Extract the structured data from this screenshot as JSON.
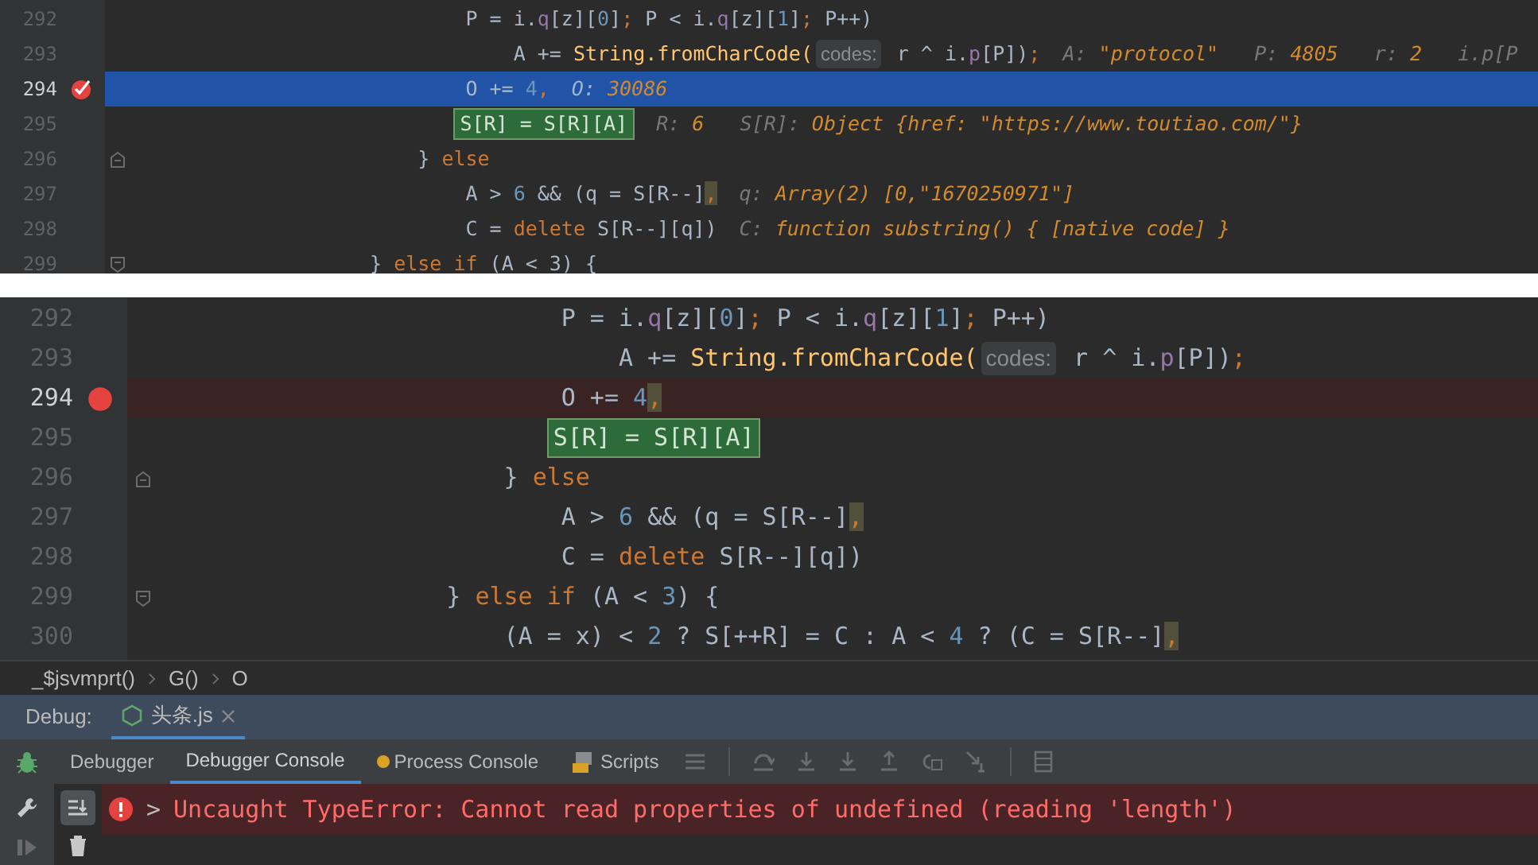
{
  "panels": [
    {
      "lines": [
        {
          "number": "292",
          "current": false,
          "breakpoint": false,
          "fold_start": false,
          "fold_end": false,
          "tokens": [
            {
              "kind": "plain",
              "text": "                            P = i."
            },
            {
              "kind": "field",
              "text": "q"
            },
            {
              "kind": "plain",
              "text": "[z]["
            },
            {
              "kind": "num",
              "text": "0"
            },
            {
              "kind": "plain",
              "text": "]"
            },
            {
              "kind": "kw",
              "text": ";"
            },
            {
              "kind": "plain",
              "text": " P < i."
            },
            {
              "kind": "field",
              "text": "q"
            },
            {
              "kind": "plain",
              "text": "[z]["
            },
            {
              "kind": "num",
              "text": "1"
            },
            {
              "kind": "plain",
              "text": "]"
            },
            {
              "kind": "kw",
              "text": ";"
            },
            {
              "kind": "plain",
              "text": " P++)"
            }
          ]
        },
        {
          "number": "293",
          "current": false,
          "breakpoint": false,
          "fold_start": false,
          "fold_end": false,
          "tokens": [
            {
              "kind": "plain",
              "text": "                                A += "
            },
            {
              "kind": "fn",
              "text": "String.fromCharCode("
            },
            {
              "kind": "hint",
              "text": "codes:"
            },
            {
              "kind": "plain",
              "text": " r ^ i."
            },
            {
              "kind": "field",
              "text": "p"
            },
            {
              "kind": "plain",
              "text": "[P])"
            },
            {
              "kind": "kw",
              "text": ";"
            }
          ],
          "values": [
            {
              "name": "A:",
              "value": "\"protocol\""
            },
            {
              "name": "P:",
              "value": "4805"
            },
            {
              "name": "r:",
              "value": "2"
            },
            {
              "name": "i.p[P"
            }
          ]
        },
        {
          "number": "294",
          "current": true,
          "breakpoint": true,
          "fold_start": false,
          "fold_end": false,
          "tokens": [
            {
              "kind": "plain",
              "text": "                            O += "
            },
            {
              "kind": "num",
              "text": "4"
            },
            {
              "kind": "kw",
              "text": ","
            }
          ],
          "values": [
            {
              "name": "O:",
              "value": "30086"
            }
          ]
        },
        {
          "number": "295",
          "current": false,
          "breakpoint": false,
          "fold_start": false,
          "fold_end": false,
          "tokens": [
            {
              "kind": "boxed",
              "text": "                           S[R] = S[R][A]"
            }
          ],
          "values": [
            {
              "name": "R:",
              "value": "6"
            },
            {
              "name": "S[R]:",
              "value": "Object {href: \"https://www.toutiao.com/\"}"
            }
          ]
        },
        {
          "number": "296",
          "current": false,
          "breakpoint": false,
          "fold_start": false,
          "fold_end": true,
          "tokens": [
            {
              "kind": "plain",
              "text": "                        } "
            },
            {
              "kind": "kw",
              "text": "else"
            }
          ]
        },
        {
          "number": "297",
          "current": false,
          "breakpoint": false,
          "fold_start": false,
          "fold_end": false,
          "tokens": [
            {
              "kind": "plain",
              "text": "                            A > "
            },
            {
              "kind": "num",
              "text": "6"
            },
            {
              "kind": "plain",
              "text": " && (q = S[R--]"
            },
            {
              "kind": "mark",
              "text": ","
            }
          ],
          "values": [
            {
              "name": "q:",
              "value": "Array(2) [0,\"1670250971\"]"
            }
          ]
        },
        {
          "number": "298",
          "current": false,
          "breakpoint": false,
          "fold_start": false,
          "fold_end": false,
          "tokens": [
            {
              "kind": "plain",
              "text": "                            C = "
            },
            {
              "kind": "kw",
              "text": "delete"
            },
            {
              "kind": "plain",
              "text": " S[R--][q])"
            }
          ],
          "values": [
            {
              "name": "C:",
              "value": "function substring() { [native code] }"
            }
          ]
        },
        {
          "number": "299",
          "current": false,
          "breakpoint": false,
          "fold_start": true,
          "fold_end": false,
          "tokens": [
            {
              "kind": "plain",
              "text": "                    } "
            },
            {
              "kind": "kw",
              "text": "else if"
            },
            {
              "kind": "plain",
              "text": " (A < 3) {"
            }
          ]
        }
      ]
    },
    {
      "lines": [
        {
          "number": "292",
          "current": false,
          "breakpoint": false,
          "fold_start": false,
          "fold_end": false,
          "tokens": [
            {
              "kind": "plain",
              "text": "                            P = i."
            },
            {
              "kind": "field",
              "text": "q"
            },
            {
              "kind": "plain",
              "text": "[z]["
            },
            {
              "kind": "num",
              "text": "0"
            },
            {
              "kind": "plain",
              "text": "]"
            },
            {
              "kind": "kw",
              "text": ";"
            },
            {
              "kind": "plain",
              "text": " P < i."
            },
            {
              "kind": "field",
              "text": "q"
            },
            {
              "kind": "plain",
              "text": "[z]["
            },
            {
              "kind": "num",
              "text": "1"
            },
            {
              "kind": "plain",
              "text": "]"
            },
            {
              "kind": "kw",
              "text": ";"
            },
            {
              "kind": "plain",
              "text": " P++)"
            }
          ]
        },
        {
          "number": "293",
          "current": false,
          "breakpoint": false,
          "fold_start": false,
          "fold_end": false,
          "tokens": [
            {
              "kind": "plain",
              "text": "                                A += "
            },
            {
              "kind": "fn",
              "text": "String.fromCharCode("
            },
            {
              "kind": "hint",
              "text": "codes:"
            },
            {
              "kind": "plain",
              "text": " r ^ i."
            },
            {
              "kind": "field",
              "text": "p"
            },
            {
              "kind": "plain",
              "text": "[P])"
            },
            {
              "kind": "kw",
              "text": ";"
            }
          ]
        },
        {
          "number": "294",
          "current": false,
          "breakpoint": true,
          "fold_start": false,
          "fold_end": false,
          "tokens": [
            {
              "kind": "plain",
              "text": "                            O += "
            },
            {
              "kind": "num",
              "text": "4"
            },
            {
              "kind": "mark",
              "text": ","
            }
          ]
        },
        {
          "number": "295",
          "current": false,
          "breakpoint": false,
          "fold_start": false,
          "fold_end": false,
          "tokens": [
            {
              "kind": "boxed",
              "text": "                           S[R] = S[R][A]"
            }
          ]
        },
        {
          "number": "296",
          "current": false,
          "breakpoint": false,
          "fold_start": false,
          "fold_end": true,
          "tokens": [
            {
              "kind": "plain",
              "text": "                        } "
            },
            {
              "kind": "kw",
              "text": "else"
            }
          ]
        },
        {
          "number": "297",
          "current": false,
          "breakpoint": false,
          "fold_start": false,
          "fold_end": false,
          "tokens": [
            {
              "kind": "plain",
              "text": "                            A > "
            },
            {
              "kind": "num",
              "text": "6"
            },
            {
              "kind": "plain",
              "text": " && (q = S[R--]"
            },
            {
              "kind": "mark",
              "text": ","
            }
          ]
        },
        {
          "number": "298",
          "current": false,
          "breakpoint": false,
          "fold_start": false,
          "fold_end": false,
          "tokens": [
            {
              "kind": "plain",
              "text": "                            C = "
            },
            {
              "kind": "kw",
              "text": "delete"
            },
            {
              "kind": "plain",
              "text": " S[R--][q])"
            }
          ]
        },
        {
          "number": "299",
          "current": false,
          "breakpoint": false,
          "fold_start": true,
          "fold_end": false,
          "tokens": [
            {
              "kind": "plain",
              "text": "                    } "
            },
            {
              "kind": "kw",
              "text": "else if"
            },
            {
              "kind": "plain",
              "text": " (A < "
            },
            {
              "kind": "num",
              "text": "3"
            },
            {
              "kind": "plain",
              "text": ") {"
            }
          ]
        },
        {
          "number": "300",
          "current": false,
          "breakpoint": false,
          "fold_start": false,
          "fold_end": false,
          "tokens": [
            {
              "kind": "plain",
              "text": "                        (A = x) < "
            },
            {
              "kind": "num",
              "text": "2"
            },
            {
              "kind": "plain",
              "text": " ? S[++R] = C : A < "
            },
            {
              "kind": "num",
              "text": "4"
            },
            {
              "kind": "plain",
              "text": " ? (C = S[R--]"
            },
            {
              "kind": "mark",
              "text": ","
            }
          ]
        }
      ]
    }
  ],
  "breadcrumbs": [
    "_$jsvmprt()",
    "G()",
    "O"
  ],
  "debug": {
    "label": "Debug:",
    "tabs": [
      {
        "label": "头条.js",
        "selected": true
      }
    ]
  },
  "toolbar_tabs": [
    {
      "label": "Debugger",
      "selected": false,
      "kind": "plain"
    },
    {
      "label": "Debugger Console",
      "selected": true,
      "kind": "plain"
    },
    {
      "label": "Process Console",
      "selected": false,
      "kind": "process"
    },
    {
      "label": "Scripts",
      "selected": false,
      "kind": "scripts"
    }
  ],
  "console": {
    "prompt": ">",
    "message": "Uncaught TypeError: Cannot read properties of undefined (reading 'length')"
  }
}
